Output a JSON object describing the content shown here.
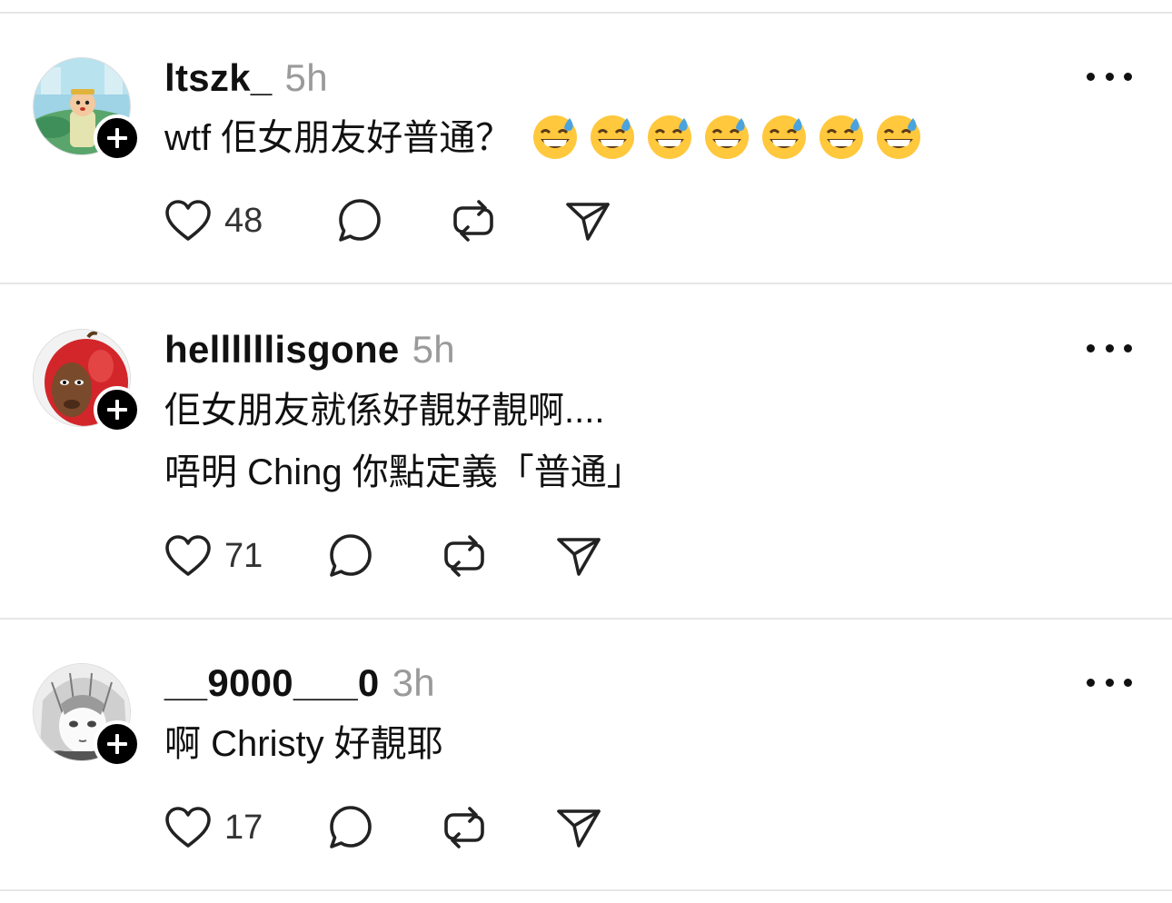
{
  "posts": [
    {
      "username": "ltszk_",
      "time": "5h",
      "lines": [
        "wtf 佢女朋友好普通？"
      ],
      "emoji_count": 7,
      "emoji": "grinning-face-with-sweat",
      "likes": "48",
      "avatar": "cartoon-character-avatar"
    },
    {
      "username": "hellllllisgone",
      "time": "5h",
      "lines": [
        "佢女朋友就係好靚好靚啊....",
        "唔明 Ching 你點定義「普通」"
      ],
      "likes": "71",
      "avatar": "apple-face-avatar"
    },
    {
      "username": "__9000___0",
      "time": "3h",
      "lines": [
        "啊 Christy 好靚耶"
      ],
      "likes": "17",
      "avatar": "manga-girl-avatar"
    }
  ],
  "colors": {
    "text": "#111111",
    "muted": "#9a9a9a",
    "divider": "#e6e6e6",
    "badge": "#000000"
  }
}
